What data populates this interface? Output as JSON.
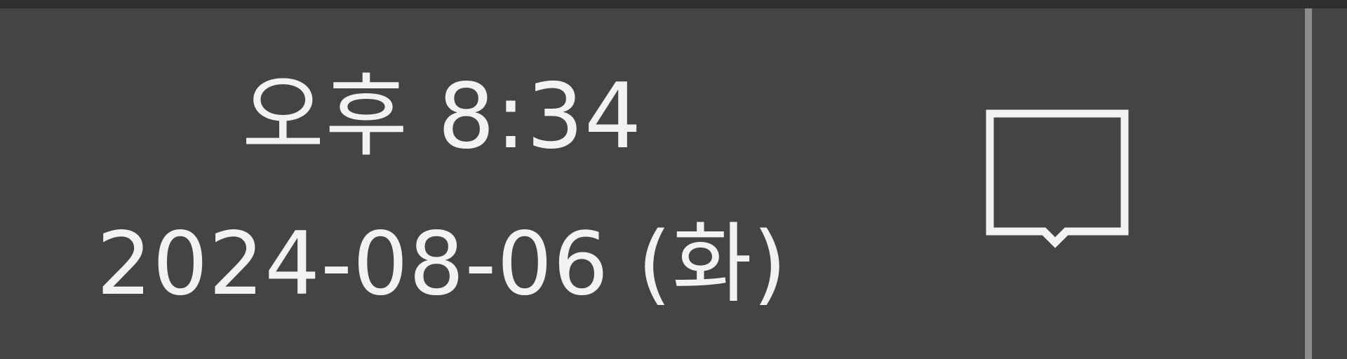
{
  "taskbar": {
    "clock": {
      "time": "오후 8:34",
      "date": "2024-08-06 (화)"
    },
    "notification": {
      "icon": "notification-center-icon"
    },
    "colors": {
      "background": "#444444",
      "text": "#f2f2f2",
      "top_border": "#2f2f2f",
      "divider": "#8c8c8c"
    }
  }
}
